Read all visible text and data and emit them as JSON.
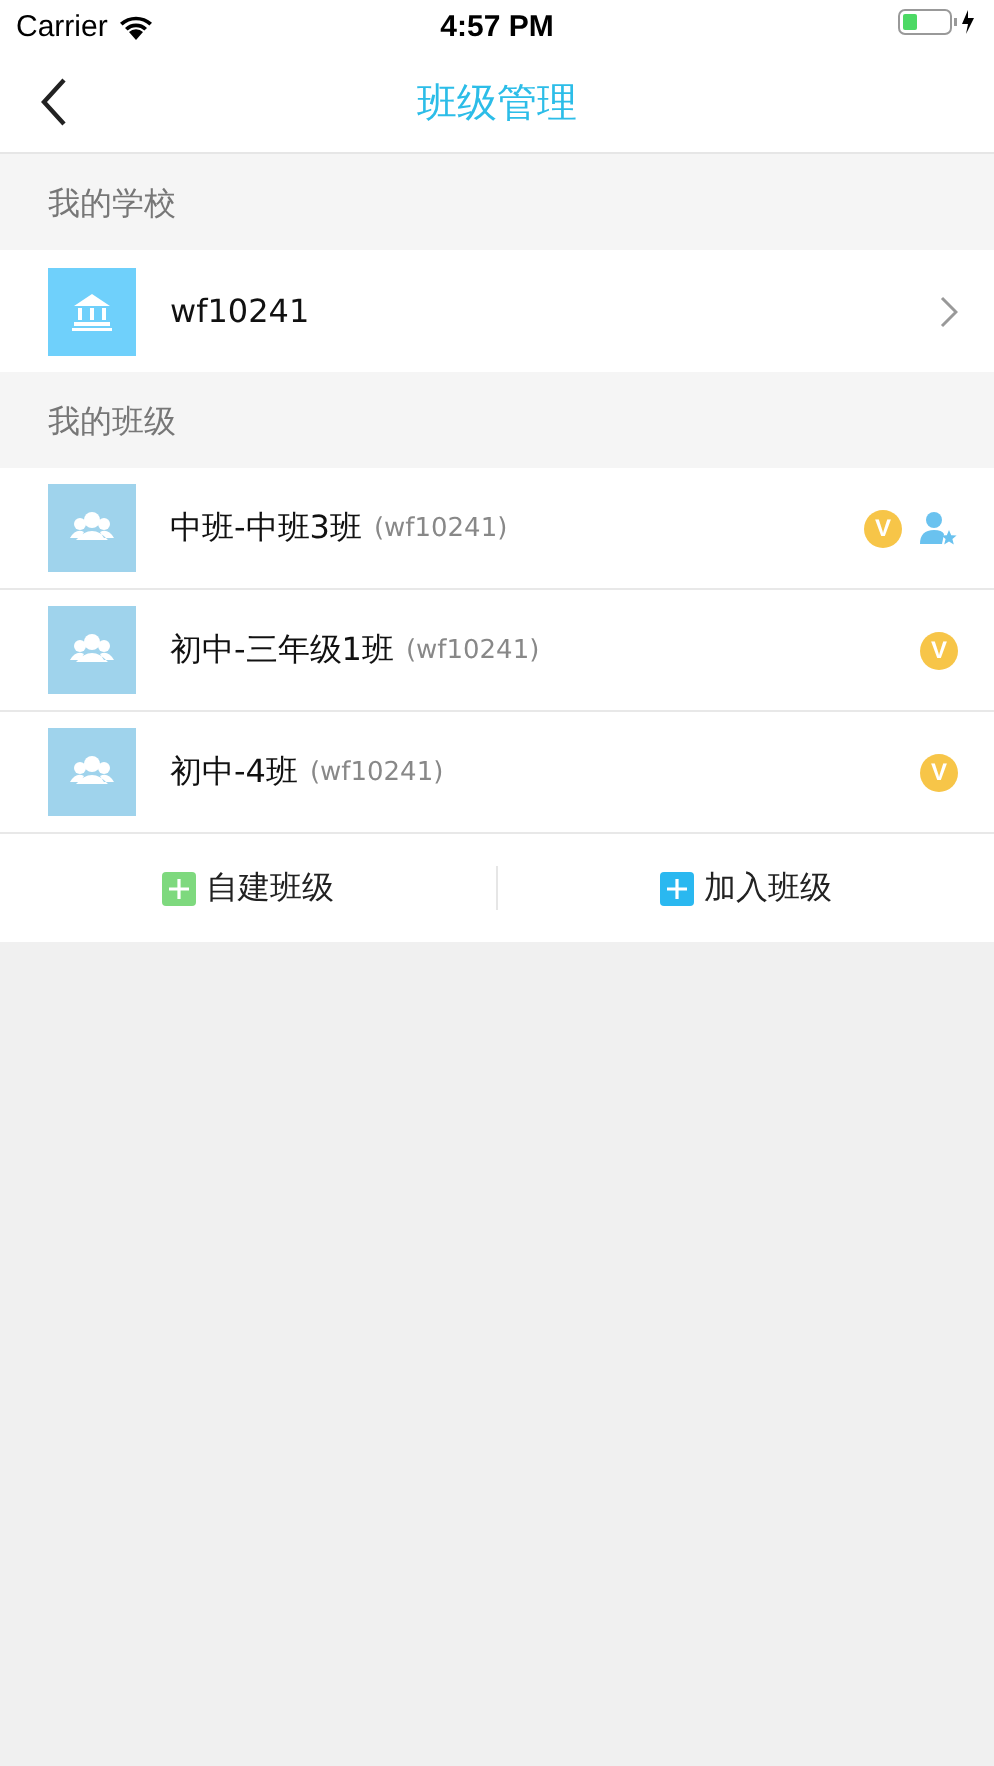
{
  "status_bar": {
    "carrier": "Carrier",
    "time": "4:57 PM"
  },
  "nav": {
    "title": "班级管理"
  },
  "school_section": {
    "header": "我的学校",
    "items": [
      {
        "name": "wf10241"
      }
    ]
  },
  "class_section": {
    "header": "我的班级",
    "items": [
      {
        "name": "中班-中班3班",
        "school": "(wf10241)",
        "badge": "V",
        "head_teacher": true
      },
      {
        "name": "初中-三年级1班",
        "school": "(wf10241)",
        "badge": "V",
        "head_teacher": false
      },
      {
        "name": "初中-4班",
        "school": "(wf10241)",
        "badge": "V",
        "head_teacher": false
      }
    ]
  },
  "actions": [
    {
      "label": "自建班级",
      "color": "#7ed97e"
    },
    {
      "label": "加入班级",
      "color": "#2ab8f0"
    }
  ]
}
